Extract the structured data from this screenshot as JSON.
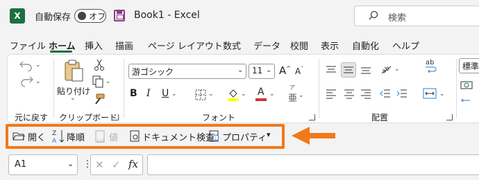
{
  "app": {
    "logo_letter": "X",
    "autosave_label": "自動保存",
    "autosave_state": "オフ",
    "doc_title": "Book1  -  Excel",
    "search_placeholder": "検索"
  },
  "tabs": [
    {
      "label": "ファイル"
    },
    {
      "label": "ホーム",
      "active": true
    },
    {
      "label": "挿入"
    },
    {
      "label": "描画"
    },
    {
      "label": "ページ レイアウト"
    },
    {
      "label": "数式"
    },
    {
      "label": "データ"
    },
    {
      "label": "校閲"
    },
    {
      "label": "表示"
    },
    {
      "label": "自動化"
    },
    {
      "label": "ヘルプ"
    }
  ],
  "ribbon": {
    "undo_group_label": "元に戻す",
    "clipboard": {
      "paste_label": "貼り付け",
      "group_label": "クリップボード"
    },
    "font": {
      "name": "游ゴシック",
      "size": "11",
      "group_label": "フォント",
      "phonetic_glyph": "ア",
      "phonetic_sub": "亜"
    },
    "alignment": {
      "group_label": "配置",
      "wrap_glyph": "ab"
    },
    "number": {
      "format": "標準"
    }
  },
  "qat": {
    "open": "開く",
    "sort_desc": "降順",
    "value": "値",
    "doc_inspect": "ドキュメント検査",
    "properties": "プロパティ",
    "more": "▾"
  },
  "formula_bar": {
    "cell_ref": "A1",
    "fx": "fx",
    "cancel": "✕",
    "confirm": "✓"
  },
  "colors": {
    "accent_green": "#1d6f42",
    "highlight_orange": "#f07a1a",
    "font_color_red": "#d13438",
    "highlight_yellow": "#ffff00"
  }
}
